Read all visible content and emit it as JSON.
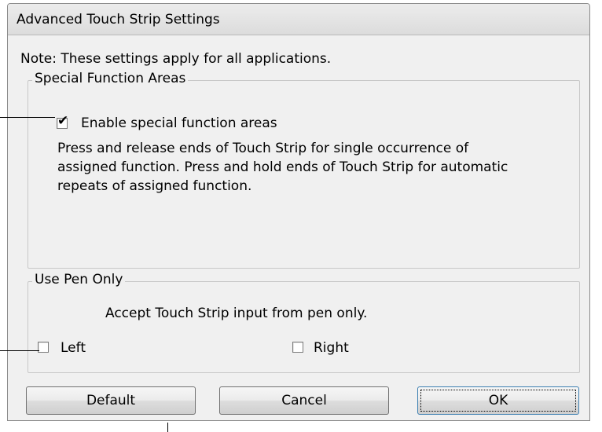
{
  "dialog": {
    "title": "Advanced Touch Strip Settings",
    "note": "Note: These settings apply for all applications."
  },
  "special_function_areas": {
    "legend": "Special Function Areas",
    "enable_checkbox": {
      "label": "Enable special function areas",
      "checked": true
    },
    "description_lines": [
      "Press and release ends of Touch Strip for single occurrence of",
      "assigned function. Press and hold ends of Touch Strip for automatic",
      "repeats of assigned function."
    ]
  },
  "use_pen_only": {
    "legend": "Use Pen Only",
    "description": "Accept Touch Strip input from pen only.",
    "left_checkbox": {
      "label": "Left",
      "checked": false
    },
    "right_checkbox": {
      "label": "Right",
      "checked": false
    }
  },
  "buttons": {
    "default_label": "Default",
    "cancel_label": "Cancel",
    "ok_label": "OK"
  },
  "icons": {
    "checkmark": "✔"
  }
}
